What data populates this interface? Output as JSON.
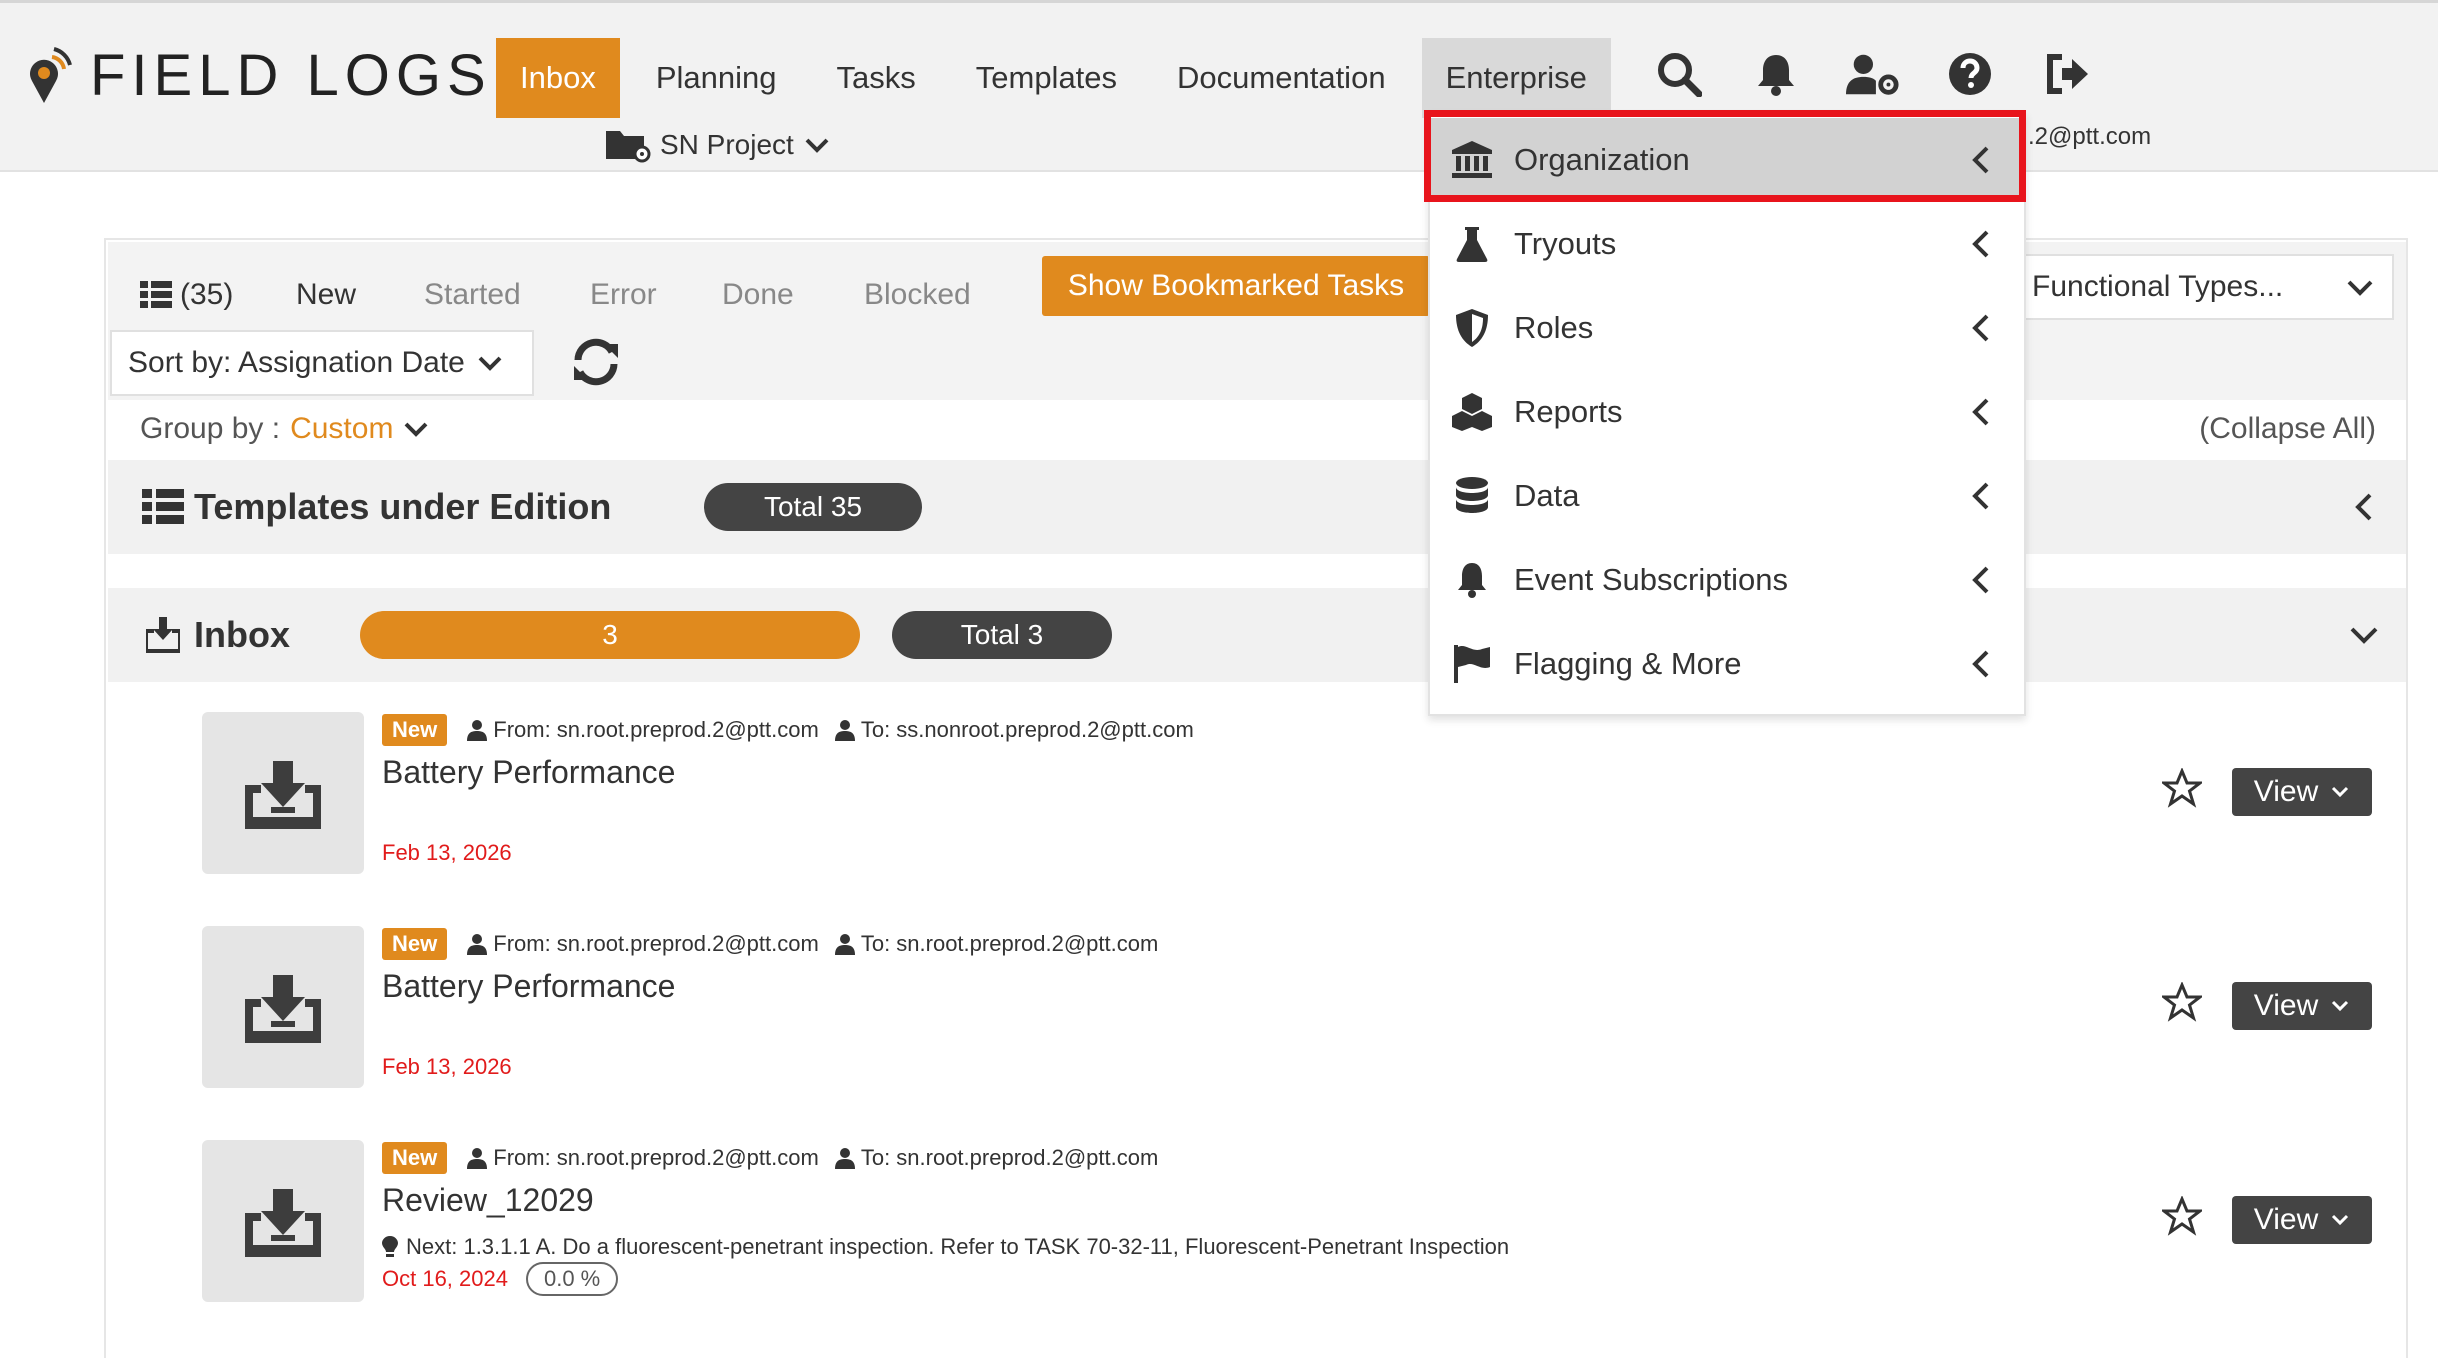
{
  "brand": {
    "name": "FIELD LOGS",
    "accent": "#e08a1e"
  },
  "nav": {
    "items": [
      {
        "label": "Inbox",
        "active": true
      },
      {
        "label": "Planning"
      },
      {
        "label": "Tasks"
      },
      {
        "label": "Templates"
      },
      {
        "label": "Documentation"
      },
      {
        "label": "Enterprise",
        "open": true
      }
    ],
    "icons": [
      "search-icon",
      "bell-icon",
      "user-settings-icon",
      "help-icon",
      "logout-icon"
    ]
  },
  "project": {
    "label": "SN Project"
  },
  "user": {
    "email_partial": ".2@ptt.com"
  },
  "filters": {
    "count": "(35)",
    "tabs": [
      "New",
      "Started",
      "Error",
      "Done",
      "Blocked"
    ],
    "bookmarked_button": "Show Bookmarked Tasks",
    "functional_types": "Functional Types...",
    "sort_label": "Sort by: Assignation Date",
    "group_by_label": "Group by :",
    "group_by_value": "Custom",
    "collapse_all": "(Collapse All)"
  },
  "sections": {
    "templates": {
      "title": "Templates under Edition",
      "total": "Total 35"
    },
    "inbox": {
      "title": "Inbox",
      "count": "3",
      "total": "Total 3"
    }
  },
  "tasks": [
    {
      "badge": "New",
      "from": "From: sn.root.preprod.2@ptt.com",
      "to": "To: ss.nonroot.preprod.2@ptt.com",
      "title": "Battery Performance",
      "date": "Feb 13, 2026",
      "view": "View"
    },
    {
      "badge": "New",
      "from": "From: sn.root.preprod.2@ptt.com",
      "to": "To: sn.root.preprod.2@ptt.com",
      "title": "Battery Performance",
      "date": "Feb 13, 2026",
      "view": "View"
    },
    {
      "badge": "New",
      "from": "From: sn.root.preprod.2@ptt.com",
      "to": "To: sn.root.preprod.2@ptt.com",
      "title": "Review_12029",
      "next": "Next: 1.3.1.1 A. Do a fluorescent-penetrant inspection. Refer to TASK 70-32-11, Fluorescent-Penetrant Inspection",
      "date": "Oct 16, 2024",
      "progress": "0.0 %",
      "view": "View"
    }
  ],
  "enterprise_menu": {
    "items": [
      {
        "label": "Organization",
        "icon": "bank-icon",
        "highlighted": true
      },
      {
        "label": "Tryouts",
        "icon": "flask-icon"
      },
      {
        "label": "Roles",
        "icon": "shield-icon"
      },
      {
        "label": "Reports",
        "icon": "cubes-icon"
      },
      {
        "label": "Data",
        "icon": "database-icon"
      },
      {
        "label": "Event Subscriptions",
        "icon": "bell-icon"
      },
      {
        "label": "Flagging & More",
        "icon": "flag-icon"
      }
    ]
  },
  "colors": {
    "accent": "#e08a1e",
    "dark_pill": "#444444",
    "date_red": "#e11b1b",
    "highlight_box": "#e8141c"
  }
}
